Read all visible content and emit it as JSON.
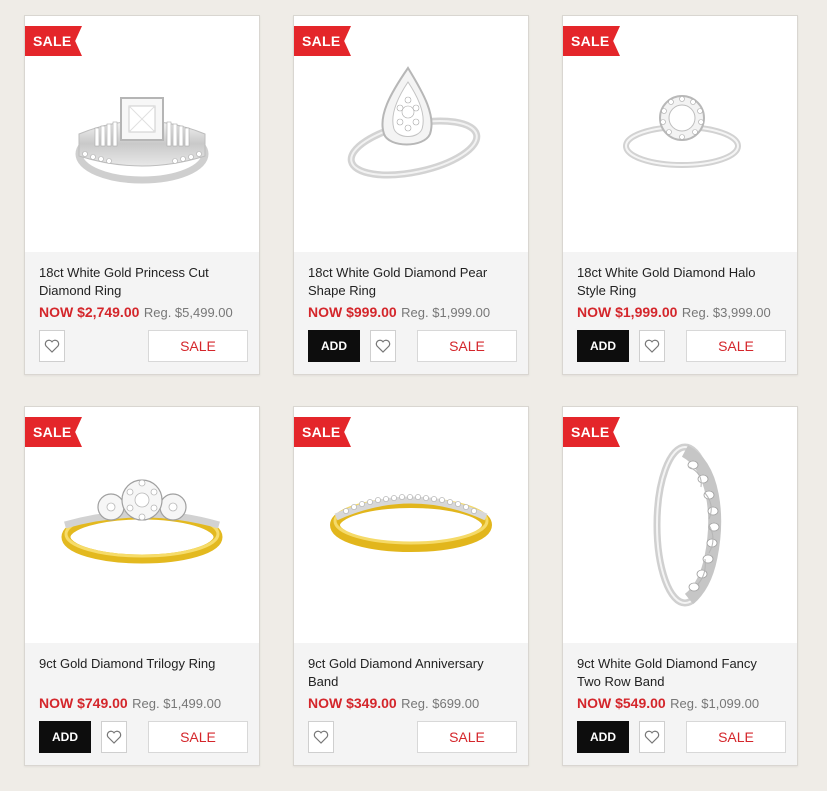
{
  "colors": {
    "page_bg": "#efece7",
    "sale_red": "#e4262a",
    "price_red": "#d4262b",
    "add_black": "#0d0d0d"
  },
  "products": [
    {
      "badge": "SALE",
      "name": "18ct White Gold Princess Cut Diamond Ring",
      "now_price": "NOW $2,749.00",
      "reg_price": "Reg. $5,499.00",
      "add_label": "",
      "sale_label": "SALE",
      "image_icon": "princess-cut-ring-icon"
    },
    {
      "badge": "SALE",
      "name": "18ct White Gold Diamond Pear Shape Ring",
      "now_price": "NOW $999.00",
      "reg_price": "Reg. $1,999.00",
      "add_label": "ADD",
      "sale_label": "SALE",
      "image_icon": "pear-shape-ring-icon"
    },
    {
      "badge": "SALE",
      "name": "18ct White Gold Diamond Halo Style Ring",
      "now_price": "NOW $1,999.00",
      "reg_price": "Reg. $3,999.00",
      "add_label": "ADD",
      "sale_label": "SALE",
      "image_icon": "halo-ring-icon"
    },
    {
      "badge": "SALE",
      "name": "9ct Gold Diamond Trilogy Ring",
      "now_price": "NOW $749.00",
      "reg_price": "Reg. $1,499.00",
      "add_label": "ADD",
      "sale_label": "SALE",
      "image_icon": "trilogy-ring-icon"
    },
    {
      "badge": "SALE",
      "name": "9ct Gold Diamond Anniversary Band",
      "now_price": "NOW $349.00",
      "reg_price": "Reg. $699.00",
      "add_label": "",
      "sale_label": "SALE",
      "image_icon": "anniversary-band-icon"
    },
    {
      "badge": "SALE",
      "name": "9ct White Gold Diamond Fancy Two Row Band",
      "now_price": "NOW $549.00",
      "reg_price": "Reg. $1,099.00",
      "add_label": "ADD",
      "sale_label": "SALE",
      "image_icon": "fancy-two-row-band-icon"
    }
  ]
}
